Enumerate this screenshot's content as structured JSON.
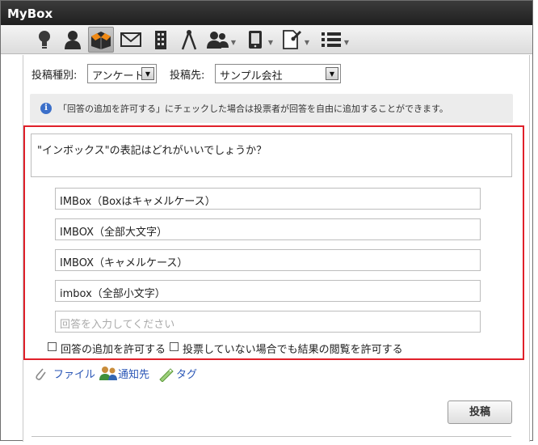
{
  "app": {
    "title": "MyBox"
  },
  "toolbar": {
    "icons": [
      "bulb-icon",
      "user-icon",
      "box-icon",
      "mail-icon",
      "building-icon",
      "compass-icon",
      "users-icon",
      "tablet-icon",
      "document-pin-icon",
      "list-icon"
    ]
  },
  "form": {
    "type_label": "投稿種別:",
    "type_value": "アンケート",
    "dest_label": "投稿先:",
    "dest_value": "サンプル会社",
    "info": "「回答の追加を許可する」にチェックした場合は投票者が回答を自由に追加することができます。",
    "question": "\"インボックス\"の表記はどれがいいでしょうか？",
    "answers": [
      "IMBox（Boxはキャメルケース）",
      "IMBOX（全部大文字）",
      "IMBOX（キャメルケース）",
      "imbox（全部小文字）"
    ],
    "answer_placeholder": "回答を入力してください",
    "allow_add_label": "回答の追加を許可する",
    "allow_view_label": "投票していない場合でも結果の閲覧を許可する",
    "file_label": "ファイル",
    "notify_label": "通知先",
    "tag_label": "タグ",
    "submit_label": "投稿"
  },
  "colors": {
    "highlight": "#e0202a",
    "link": "#2a56b6",
    "titlebar": "#2a2a2a"
  }
}
